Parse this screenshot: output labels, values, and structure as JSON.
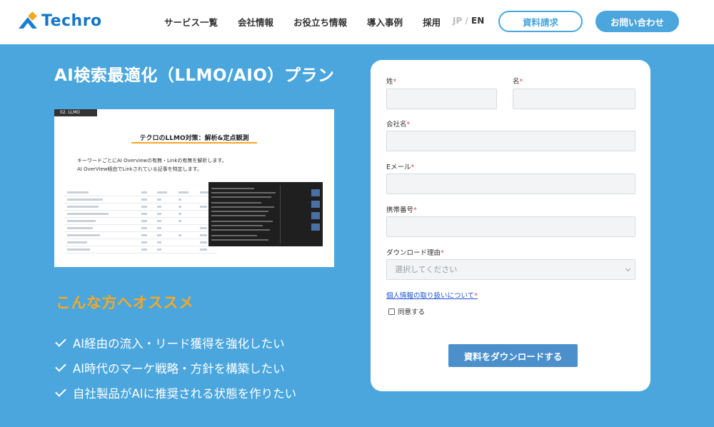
{
  "header": {
    "logo_text": "Techro",
    "nav": [
      "サービス一覧",
      "会社情報",
      "お役立ち情報",
      "導入事例",
      "採用"
    ],
    "lang_jp": "JP",
    "lang_sep": "/",
    "lang_en": "EN",
    "request_docs": "資料請求",
    "contact": "お問い合わせ"
  },
  "hero": {
    "title": "AI検索最適化（LLMO/AIO）プラン"
  },
  "screenshot": {
    "tag": "02. LLMO",
    "title": "テクロのLLMO対策：解析&定点観測",
    "desc_line1": "キーワードごとにAI Overviewの有無・Linkの有無を解析します。",
    "desc_line2": "AI OverView経由でLinkされている記事を特定します。"
  },
  "recommend": {
    "title": "こんな方へオススメ",
    "items": [
      "AI経由の流入・リード獲得を強化したい",
      "AI時代のマーケ戦略・方針を構築したい",
      "自社製品がAIに推奨される状態を作りたい"
    ]
  },
  "form": {
    "last_name_label": "姓",
    "first_name_label": "名",
    "company_label": "会社名",
    "email_label": "Eメール",
    "phone_label": "携帯番号",
    "reason_label": "ダウンロード理由",
    "required_mark": "*",
    "reason_placeholder": "選択してください",
    "privacy_link": "個人情報の取り扱いについて",
    "agree_label": "同意する",
    "submit_label": "資料をダウンロードする"
  },
  "colors": {
    "background": "#4aa6dc",
    "brand": "#1677c8",
    "accent": "#f7a823",
    "button": "#4b8fcb",
    "required": "#e54646"
  }
}
